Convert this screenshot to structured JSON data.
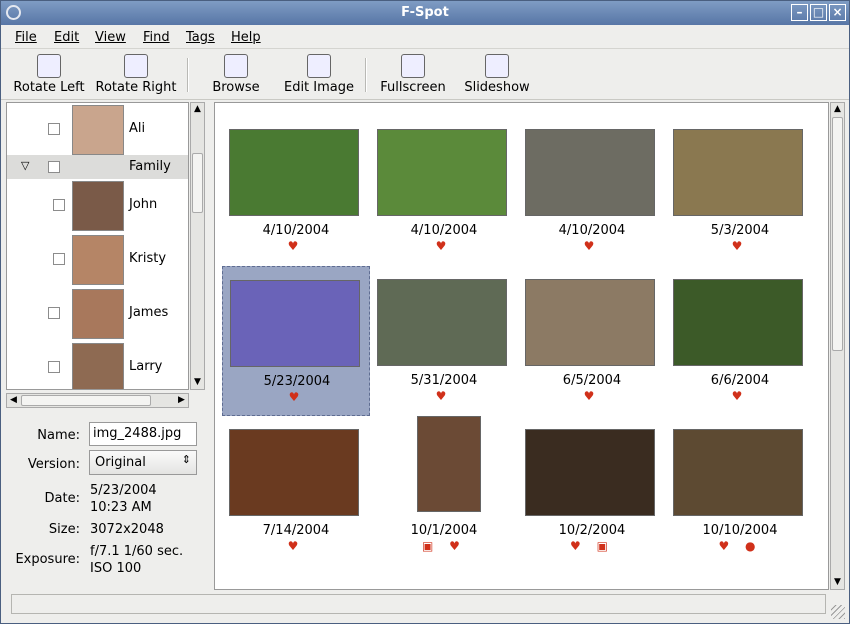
{
  "window": {
    "title": "F-Spot"
  },
  "menu": [
    "File",
    "Edit",
    "View",
    "Find",
    "Tags",
    "Help"
  ],
  "toolbar": [
    {
      "label": "Rotate Left",
      "icon": "rotate-left-icon"
    },
    {
      "label": "Rotate Right",
      "icon": "rotate-right-icon"
    },
    {
      "label": "Browse",
      "icon": "browse-icon"
    },
    {
      "label": "Edit Image",
      "icon": "edit-image-icon"
    },
    {
      "label": "Fullscreen",
      "icon": "fullscreen-icon"
    },
    {
      "label": "Slideshow",
      "icon": "slideshow-icon"
    }
  ],
  "tags_tree": {
    "top": {
      "name": "Ali"
    },
    "group": {
      "name": "Family"
    },
    "people": [
      {
        "name": "John"
      },
      {
        "name": "Kristy"
      },
      {
        "name": "James"
      },
      {
        "name": "Larry"
      }
    ]
  },
  "info": {
    "name_label": "Name:",
    "name": "img_2488.jpg",
    "version_label": "Version:",
    "version": "Original",
    "date_label": "Date:",
    "date": "5/23/2004",
    "time": "10:23 AM",
    "size_label": "Size:",
    "size": "3072x2048",
    "exposure_label": "Exposure:",
    "exposure": "f/7.1 1/60 sec.",
    "iso": "ISO 100"
  },
  "photos": [
    {
      "date": "4/10/2004",
      "tags": "♥",
      "color": "#4a7a32"
    },
    {
      "date": "4/10/2004",
      "tags": "♥",
      "color": "#5b8a3a"
    },
    {
      "date": "4/10/2004",
      "tags": "♥",
      "color": "#6d6c62"
    },
    {
      "date": "5/3/2004",
      "tags": "♥",
      "color": "#8a7850"
    },
    {
      "date": "5/23/2004",
      "tags": "♥",
      "color": "#6a63b8",
      "selected": true
    },
    {
      "date": "5/31/2004",
      "tags": "♥",
      "color": "#5f6a55"
    },
    {
      "date": "6/5/2004",
      "tags": "♥",
      "color": "#8c7a64"
    },
    {
      "date": "6/6/2004",
      "tags": "♥",
      "color": "#3c5a28"
    },
    {
      "date": "7/14/2004",
      "tags": "♥",
      "color": "#6a3a20"
    },
    {
      "date": "10/1/2004",
      "tags": "▣ ♥",
      "color": "#6b4a35"
    },
    {
      "date": "10/2/2004",
      "tags": "♥ ▣",
      "color": "#3a2c20"
    },
    {
      "date": "10/10/2004",
      "tags": "♥ ●",
      "color": "#5d4a32"
    }
  ]
}
